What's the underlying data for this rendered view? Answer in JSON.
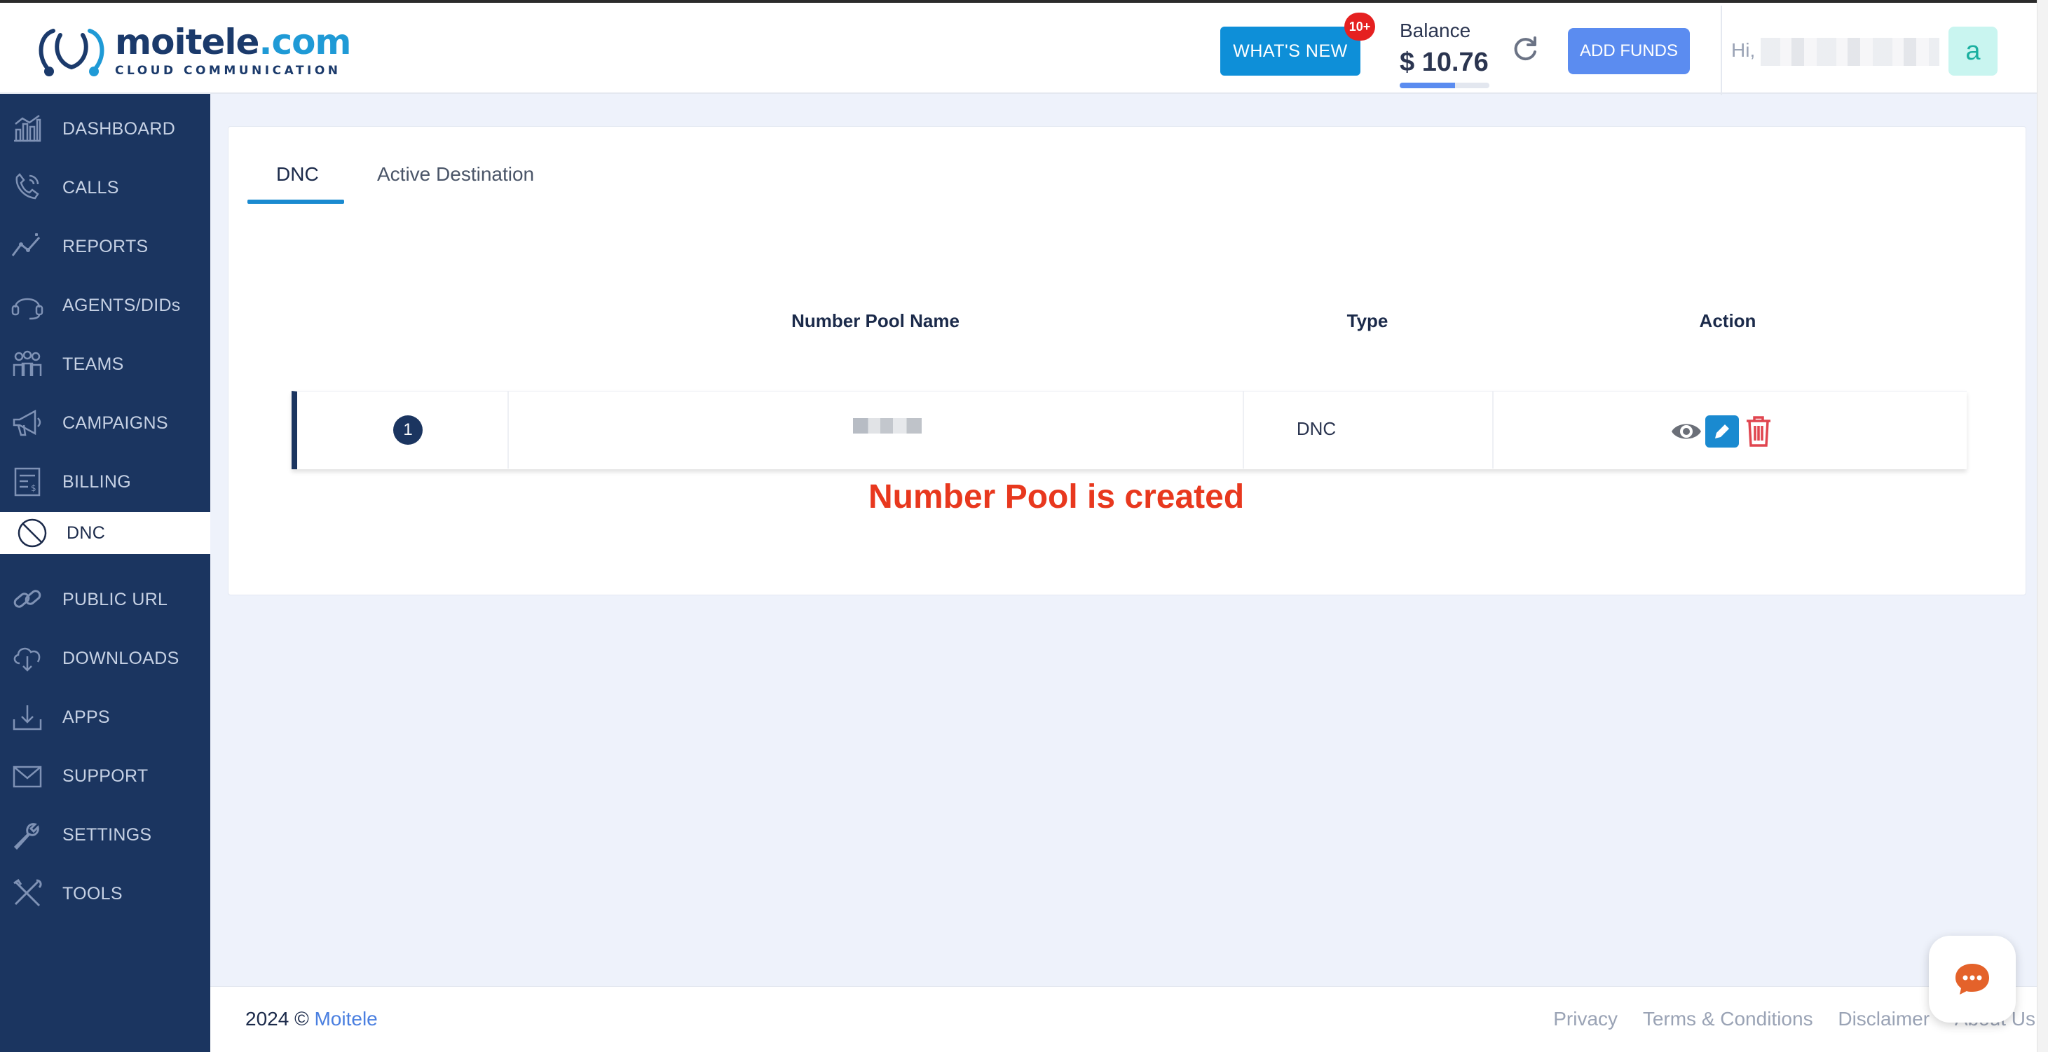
{
  "brand": {
    "name_main": "moitele",
    "name_accent": ".com",
    "tagline": "CLOUD COMMUNICATION"
  },
  "header": {
    "whats_new_label": "WHAT'S NEW",
    "whats_new_badge": "10+",
    "balance_label": "Balance",
    "balance_value": "$ 10.76",
    "balance_progress": 0.62,
    "add_funds_label": "ADD FUNDS",
    "greeting": "Hi,",
    "avatar_letter": "a"
  },
  "sidebar": {
    "items": [
      {
        "label": "DASHBOARD",
        "icon": "dashboard-icon"
      },
      {
        "label": "CALLS",
        "icon": "phone-icon"
      },
      {
        "label": "REPORTS",
        "icon": "chart-line-icon"
      },
      {
        "label": "AGENTS/DIDs",
        "icon": "headset-icon"
      },
      {
        "label": "TEAMS",
        "icon": "team-icon"
      },
      {
        "label": "CAMPAIGNS",
        "icon": "megaphone-icon"
      },
      {
        "label": "BILLING",
        "icon": "invoice-icon"
      },
      {
        "label": "DNC",
        "icon": "ban-icon",
        "active": true
      },
      {
        "label": "PUBLIC URL",
        "icon": "link-icon"
      },
      {
        "label": "DOWNLOADS",
        "icon": "cloud-download-icon"
      },
      {
        "label": "APPS",
        "icon": "download-tray-icon"
      },
      {
        "label": "SUPPORT",
        "icon": "mail-icon"
      },
      {
        "label": "SETTINGS",
        "icon": "wrench-icon"
      },
      {
        "label": "TOOLS",
        "icon": "tools-icon"
      }
    ]
  },
  "main": {
    "tabs": [
      {
        "label": "DNC",
        "active": true
      },
      {
        "label": "Active Destination"
      }
    ],
    "table": {
      "headers": [
        "Number Pool Name",
        "Type",
        "Action"
      ],
      "rows": [
        {
          "index": "1",
          "type": "DNC"
        }
      ]
    },
    "annotation": "Number Pool is created"
  },
  "footer": {
    "year": "2024 ©",
    "company_link": "Moitele",
    "links": [
      "Privacy",
      "Terms & Conditions",
      "Disclaimer",
      "About Us"
    ]
  },
  "colors": {
    "sidebar": "#1b3560",
    "primary": "#0e8fd8",
    "accent": "#5b8cf0",
    "danger": "#e8381e"
  }
}
